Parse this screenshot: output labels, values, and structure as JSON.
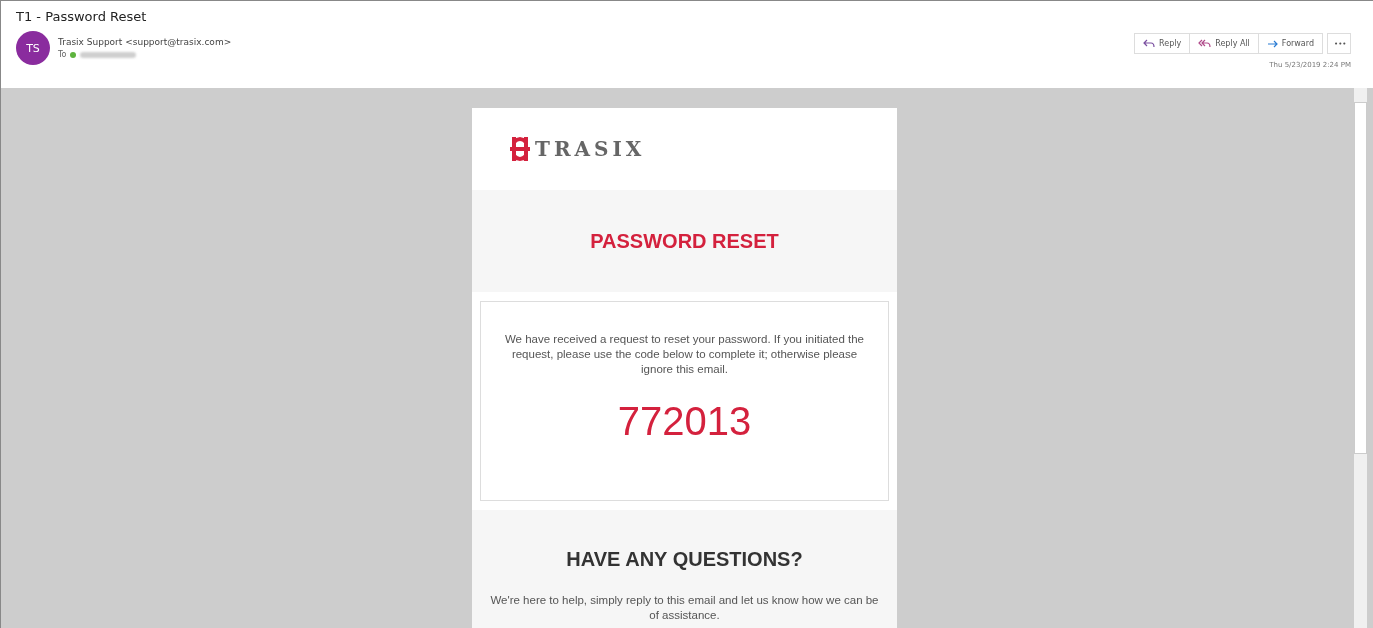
{
  "window": {
    "title": "T1 - Password Reset"
  },
  "message": {
    "avatar_initials": "TS",
    "sender": "Trasix Support <support@trasix.com>",
    "to_label": "To",
    "date": "Thu 5/23/2019 2:24 PM"
  },
  "actions": [
    {
      "kind": "reply",
      "label": "Reply"
    },
    {
      "kind": "reply_all",
      "label": "Reply All"
    },
    {
      "kind": "forward",
      "label": "Forward"
    }
  ],
  "more_button": "•••",
  "email": {
    "brand": "TRASIX",
    "heading": "PASSWORD RESET",
    "body": "We have received a request to reset your password. If you initiated the request, please use the code below to complete it; otherwise please ignore this email.",
    "code": "772013",
    "questions_heading": "HAVE ANY QUESTIONS?",
    "questions_body": "We're here to help, simply reply to this email and let us know how we can be of assistance."
  }
}
